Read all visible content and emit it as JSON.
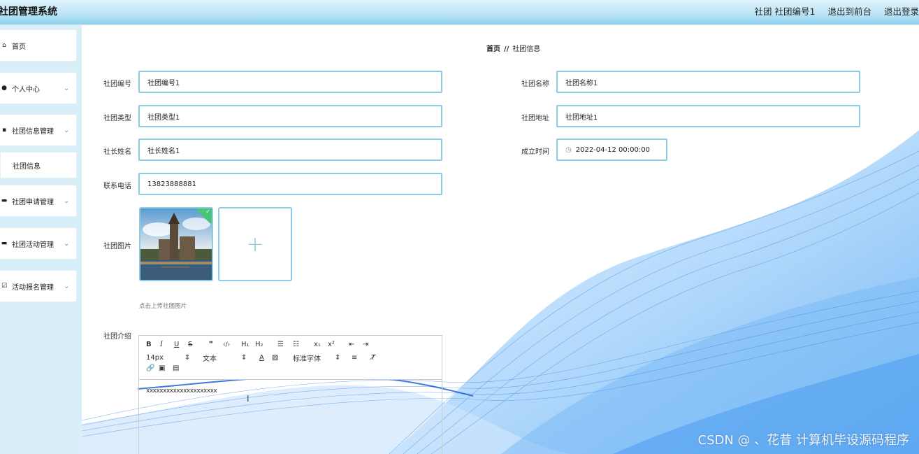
{
  "header": {
    "title": "社团管理系统",
    "user": "社团 社团编号1",
    "to_front": "退出到前台",
    "logout": "退出登录"
  },
  "sidebar": {
    "items": [
      {
        "label": "首页",
        "icon": "home-icon",
        "expandable": false
      },
      {
        "label": "个人中心",
        "icon": "user-icon",
        "expandable": true
      },
      {
        "label": "社团信息管理",
        "icon": "grid-icon",
        "expandable": true
      },
      {
        "label": "社团申请管理",
        "icon": "monitor-icon",
        "expandable": true
      },
      {
        "label": "社团活动管理",
        "icon": "monitor-icon",
        "expandable": true
      },
      {
        "label": "活动报名管理",
        "icon": "checkbox-icon",
        "expandable": true
      }
    ],
    "sub_item": "社团信息"
  },
  "breadcrumb": {
    "home": "首页",
    "separator": "//",
    "current": "社团信息"
  },
  "form": {
    "club_no": {
      "label": "社团编号",
      "value": "社团编号1"
    },
    "club_name": {
      "label": "社团名称",
      "value": "社团名称1"
    },
    "club_type": {
      "label": "社团类型",
      "value": "社团类型1"
    },
    "club_addr": {
      "label": "社团地址",
      "value": "社团地址1"
    },
    "leader": {
      "label": "社长姓名",
      "value": "社长姓名1"
    },
    "founded": {
      "label": "成立时间",
      "value": "2022-04-12 00:00:00"
    },
    "phone": {
      "label": "联系电话",
      "value": "13823888881"
    },
    "image": {
      "label": "社团图片",
      "hint": "点击上传社团图片"
    },
    "intro": {
      "label": "社团介绍",
      "content": "xxxxxxxxxxxxxxxxxxxxx",
      "toolbar": {
        "font_size": "14px",
        "text_style": "文本",
        "font_family": "标准字体"
      }
    }
  },
  "watermark": "CSDN @ 、花昔 计算机毕设源码程序",
  "colors": {
    "border": "#8ecbe4",
    "header_gradient_end": "#8fd1ef",
    "sidebar_bg": "#d8eef8",
    "success": "#48c57a"
  }
}
